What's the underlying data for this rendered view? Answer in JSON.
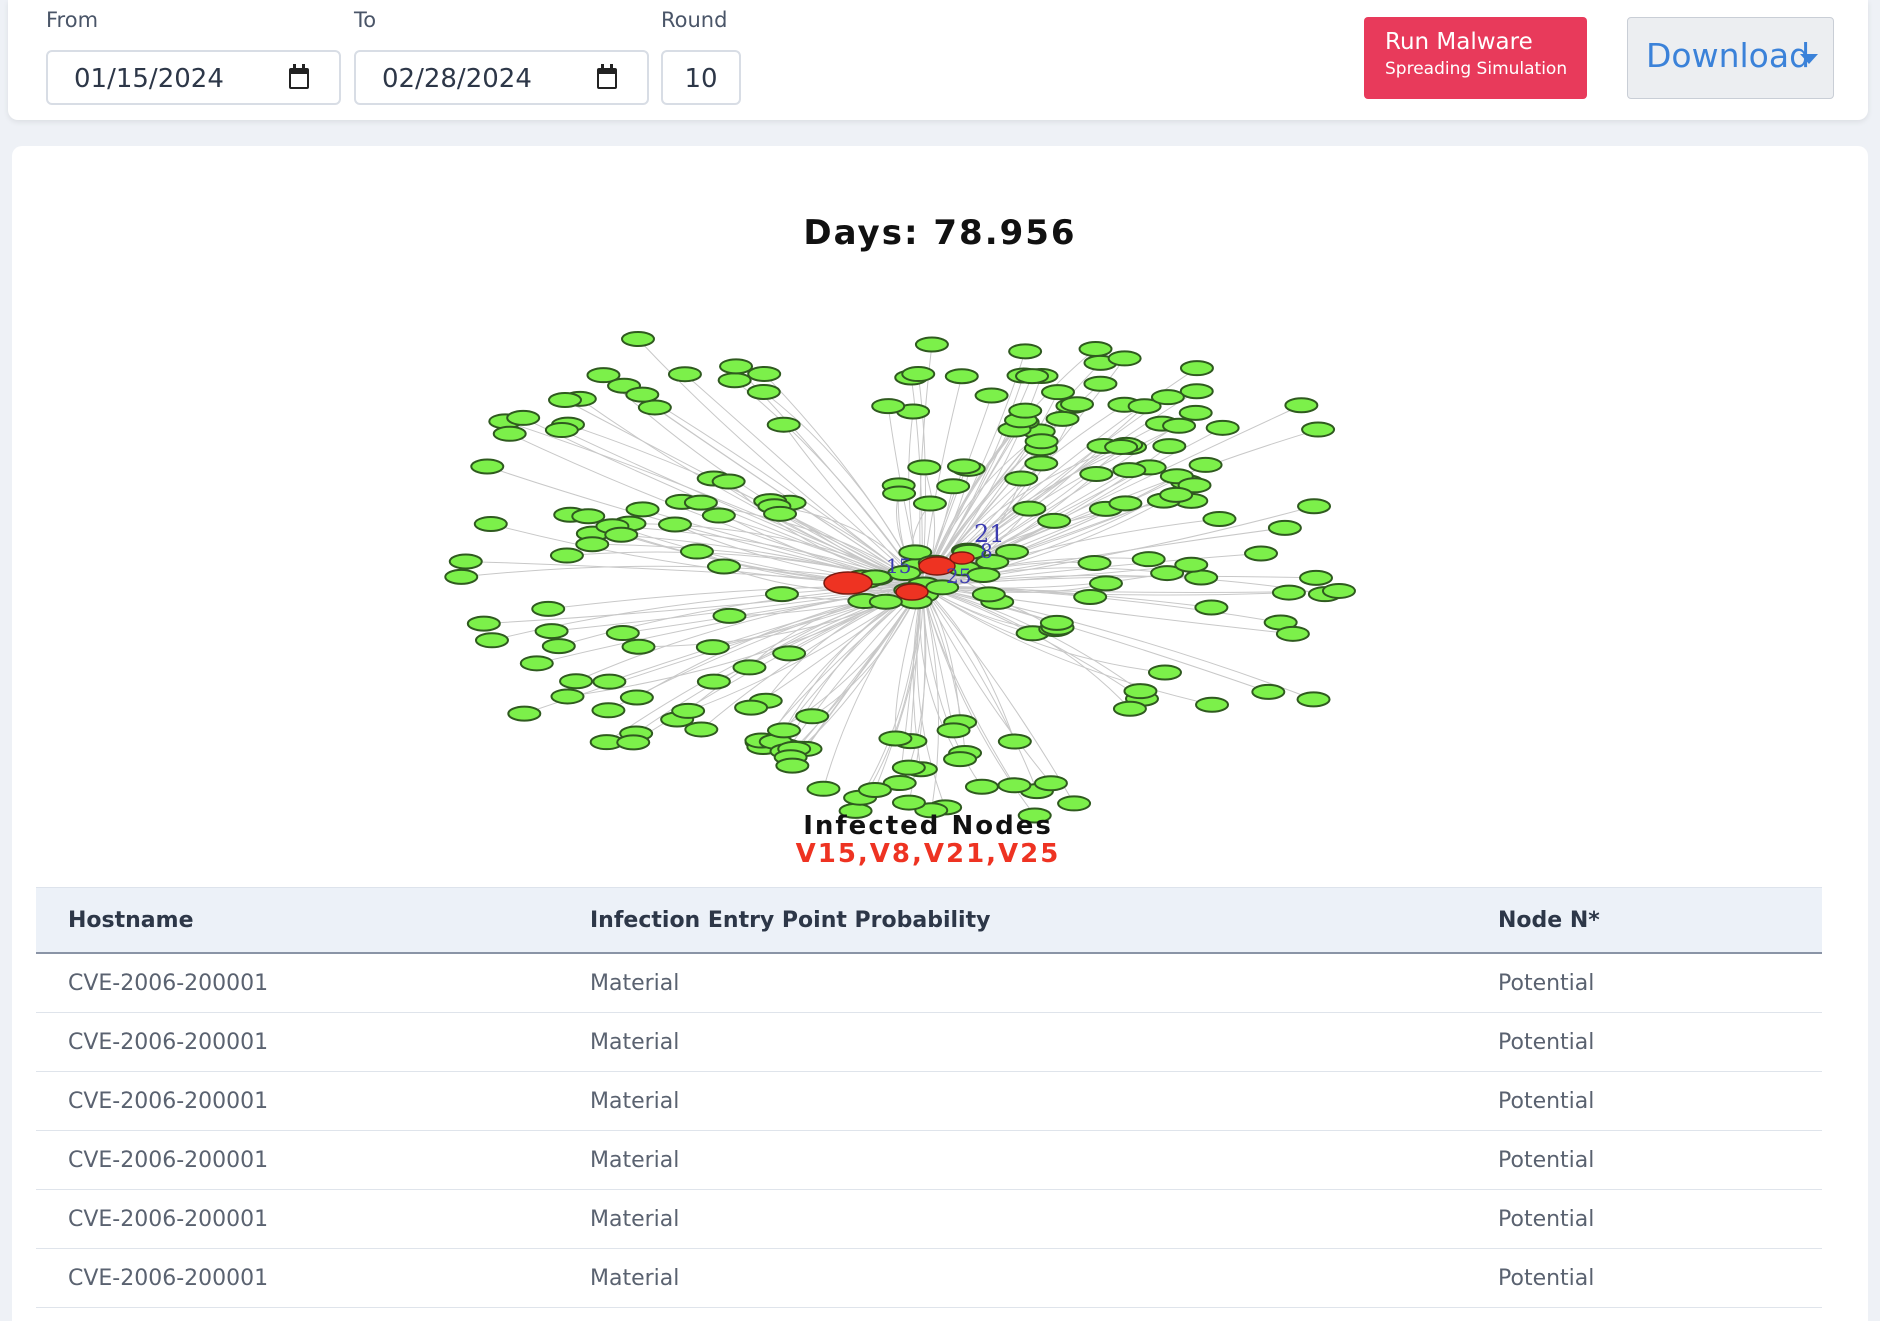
{
  "filters": {
    "from_label": "From",
    "from_value": "01/15/2024",
    "to_label": "To",
    "to_value": "02/28/2024",
    "round_label": "Round",
    "round_value": "10"
  },
  "actions": {
    "run_line1": "Run Malware",
    "run_line2": "Spreading Simulation",
    "download_label": "Download"
  },
  "graph": {
    "days_text": "Days: 78.956",
    "infected_title": "Infected Nodes",
    "infected_list": "V15,V8,V21,V25",
    "node_labels": [
      "21",
      "8",
      "15",
      "25"
    ],
    "healthy_color": "#7cf04a",
    "infected_color": "#ee3322",
    "edge_color": "#c8c8c8"
  },
  "table": {
    "headers": [
      "Hostname",
      "Infection Entry Point Probability",
      "Node N*"
    ],
    "rows": [
      [
        "CVE-2006-200001",
        "Material",
        "Potential"
      ],
      [
        "CVE-2006-200001",
        "Material",
        "Potential"
      ],
      [
        "CVE-2006-200001",
        "Material",
        "Potential"
      ],
      [
        "CVE-2006-200001",
        "Material",
        "Potential"
      ],
      [
        "CVE-2006-200001",
        "Material",
        "Potential"
      ],
      [
        "CVE-2006-200001",
        "Material",
        "Potential"
      ]
    ]
  }
}
